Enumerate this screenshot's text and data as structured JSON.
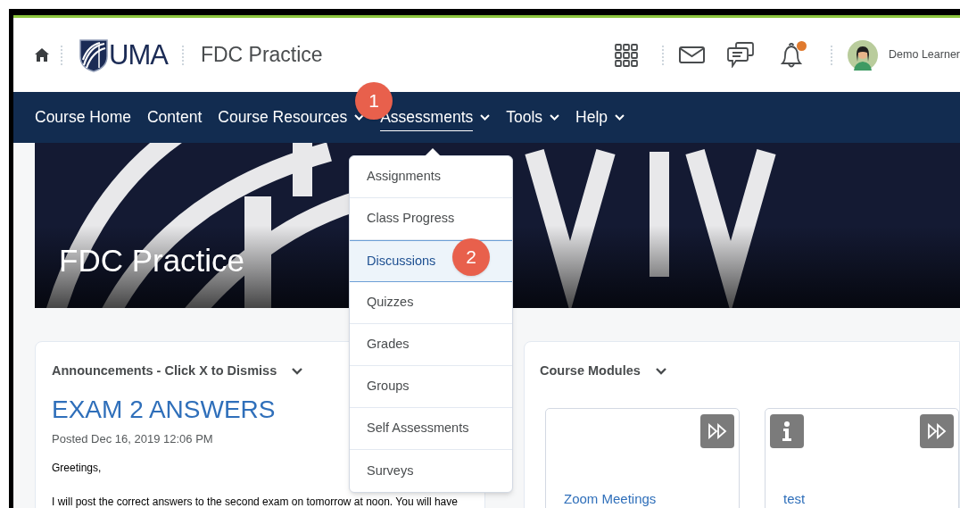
{
  "header": {
    "logo_text": "UMA",
    "course_title": "FDC Practice",
    "user_name": "Demo Learner",
    "notification_unread": true
  },
  "nav": [
    {
      "label": "Course Home",
      "has_menu": false,
      "selected": false
    },
    {
      "label": "Content",
      "has_menu": false,
      "selected": false
    },
    {
      "label": "Course Resources",
      "has_menu": true,
      "selected": false
    },
    {
      "label": "Assessments",
      "has_menu": true,
      "selected": true
    },
    {
      "label": "Tools",
      "has_menu": true,
      "selected": false
    },
    {
      "label": "Help",
      "has_menu": true,
      "selected": false
    }
  ],
  "dropdown": [
    {
      "label": "Assignments",
      "selected": false
    },
    {
      "label": "Class Progress",
      "selected": false
    },
    {
      "label": "Discussions",
      "selected": true
    },
    {
      "label": "Quizzes",
      "selected": false
    },
    {
      "label": "Grades",
      "selected": false
    },
    {
      "label": "Groups",
      "selected": false
    },
    {
      "label": "Self Assessments",
      "selected": false
    },
    {
      "label": "Surveys",
      "selected": false
    }
  ],
  "callouts": [
    "1",
    "2"
  ],
  "banner": {
    "title": "FDC Practice"
  },
  "announcements": {
    "title": "Announcements - Click X to Dismiss",
    "headline": "EXAM 2 ANSWERS",
    "posted": "Posted Dec 16, 2019 12:06 PM",
    "paragraphs": [
      "Greetings,",
      "I will post the correct answers to the second exam on tomorrow at noon. You will have"
    ]
  },
  "modules": {
    "title": "Course Modules",
    "tiles": [
      {
        "title": "Zoom Meetings",
        "info": false
      },
      {
        "title": "test",
        "info": true
      }
    ]
  }
}
